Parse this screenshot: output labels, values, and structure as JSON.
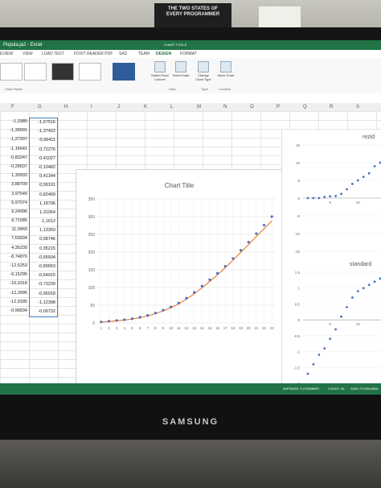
{
  "window": {
    "title": "Popula.ja2 - Excel"
  },
  "poster": {
    "line1": "THE TWO STATES OF",
    "line2": "EVERY PROGRAMMER"
  },
  "ribbon": {
    "contextual_label": "CHART TOOLS",
    "tabs": [
      "EVIEW",
      "VIEW",
      "LOAD TEST",
      "FOXIT READER PDF",
      "SAS",
      "TEAM",
      "DESIGN",
      "FORMAT"
    ],
    "commands": [
      {
        "label": "Switch Row/ Column"
      },
      {
        "label": "Select Data"
      },
      {
        "label": "Change Chart Type"
      },
      {
        "label": "Move Chart"
      }
    ],
    "groups": [
      "Chart Styles",
      "Data",
      "Type",
      "Location"
    ]
  },
  "columns": [
    "F",
    "G",
    "H",
    "I",
    "J",
    "K",
    "L",
    "M",
    "N",
    "O",
    "P",
    "Q",
    "R",
    "S"
  ],
  "sheet": {
    "colF": [
      "-1,3385",
      "-1,39091",
      "-1,27207",
      "-1,16641",
      "-0,83247",
      "-0,26637",
      "1,30933",
      "3,88709",
      "3,97549",
      "6,97074",
      "9,24996",
      "9,71585",
      "11,0469",
      "7,63934",
      "4,35239",
      "-8,74876",
      "-12,5253",
      "-9,15295",
      "-10,0318",
      "-12,3995",
      "-12,9185",
      "-0,96834"
    ],
    "colG": [
      "-1,67516",
      "-1,37422",
      "-0,99411",
      "-0,72276",
      "-0,41027",
      "-0,10482",
      "0,41344",
      "0,99101",
      "0,82469",
      "1,18796",
      "1,31054",
      "1,1612",
      "1,13359",
      "0,68746",
      "0,35215",
      "-0,65504",
      "-0,89653",
      "-0,64915",
      "-0,73239",
      "-0,96918",
      "-1,12398",
      "-0,09732"
    ]
  },
  "chart_data": [
    {
      "type": "line",
      "title": "Chart Title",
      "categories": [
        "1",
        "2",
        "3",
        "4",
        "5",
        "6",
        "7",
        "8",
        "9",
        "10",
        "11",
        "12",
        "13",
        "14",
        "15",
        "16",
        "17",
        "18",
        "19",
        "20",
        "21",
        "22",
        "23"
      ],
      "ylim": [
        0,
        350
      ],
      "yticks": [
        "0",
        "50",
        "100",
        "150",
        "200",
        "250",
        "300",
        "350"
      ],
      "series": [
        {
          "values": [
            3,
            5,
            7,
            9,
            12,
            16,
            21,
            28,
            36,
            45,
            56,
            70,
            86,
            104,
            122,
            140,
            160,
            182,
            205,
            228,
            252,
            276,
            300
          ],
          "color": "#4472c4",
          "style": "markers"
        },
        {
          "values": [
            2,
            4,
            6,
            8,
            11,
            15,
            20,
            26,
            34,
            43,
            54,
            67,
            82,
            99,
            117,
            136,
            156,
            177,
            199,
            221,
            244,
            266,
            288
          ],
          "color": "#ed7d31",
          "style": "line"
        }
      ],
      "grid": true
    },
    {
      "type": "scatter",
      "title": "rezid",
      "ylim": [
        -15,
        15
      ],
      "yticks": [
        "15",
        "10",
        "5",
        "0",
        "-5",
        "-10",
        "-15"
      ],
      "xticks": [
        "5",
        "10"
      ],
      "series": [
        {
          "x": [
            1,
            2,
            3,
            4,
            5,
            6,
            7,
            8,
            9,
            10,
            11,
            12,
            13,
            14
          ],
          "values": [
            0,
            0,
            0,
            0.3,
            0.5,
            0.6,
            1.2,
            2.5,
            4,
            5,
            6,
            7,
            9,
            10
          ],
          "color": "#4472c4"
        }
      ]
    },
    {
      "type": "scatter",
      "title": "standard",
      "ylim": [
        -2,
        1.5
      ],
      "yticks": [
        "1.5",
        "1",
        "0.5",
        "0",
        "-0.5",
        "-1",
        "-1.5",
        "-2"
      ],
      "xticks": [
        "5",
        "10"
      ],
      "series": [
        {
          "x": [
            1,
            2,
            3,
            4,
            5,
            6,
            7,
            8,
            9,
            10,
            11,
            12,
            13,
            14
          ],
          "values": [
            -1.7,
            -1.4,
            -1.1,
            -0.9,
            -0.6,
            -0.3,
            0.1,
            0.4,
            0.7,
            0.9,
            1.0,
            1.1,
            1.2,
            1.3
          ],
          "color": "#4472c4"
        }
      ]
    }
  ],
  "status": {
    "left": "AVERAGE: 5,473888909",
    "count": "COUNT: 46",
    "sum": "SUM: 273,8944545"
  },
  "monitor": {
    "brand": "SAMSUNG"
  }
}
